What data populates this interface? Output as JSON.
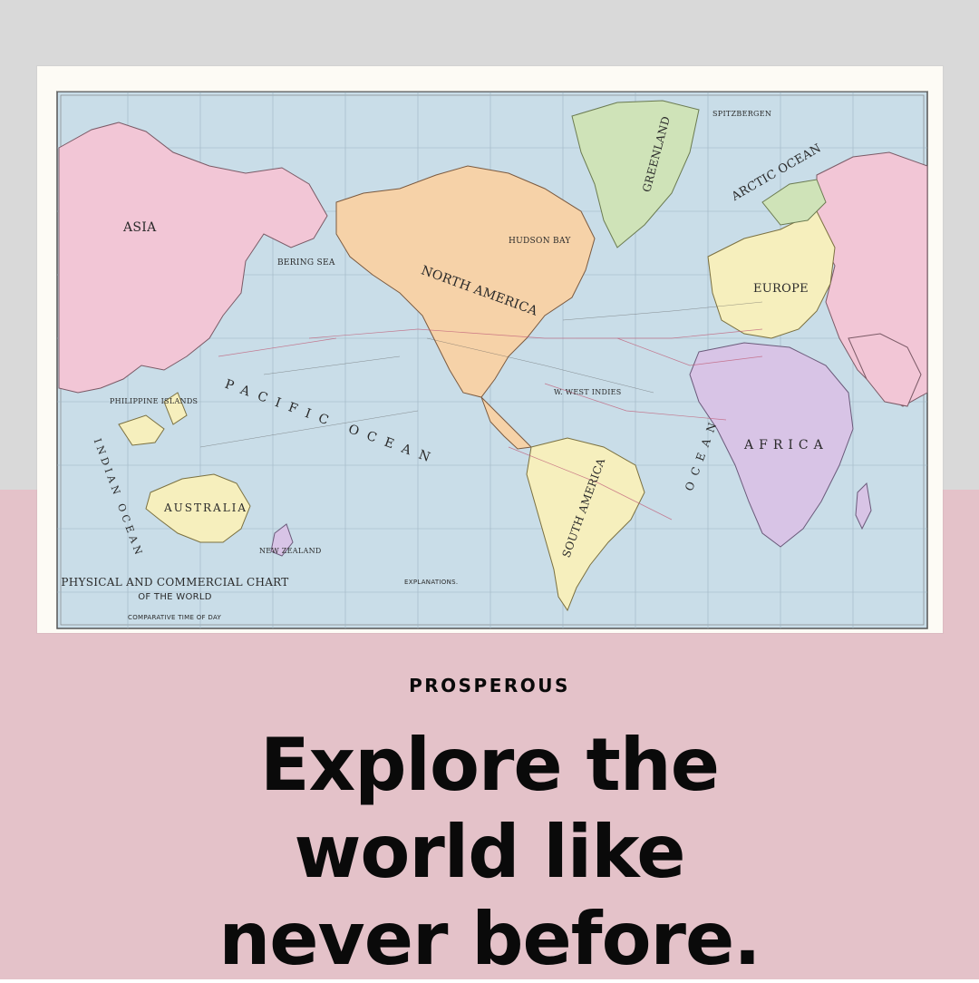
{
  "colors": {
    "top_background": "#d9d9d9",
    "bottom_background": "#e4c2c9",
    "ocean": "#c9dde8",
    "land_pink": "#f2c6d6",
    "land_orange": "#f6d2a8",
    "land_yellow": "#f6efbd",
    "land_green": "#cfe3b8",
    "land_purple": "#d8c4e6",
    "text": "#0a0a0a"
  },
  "map": {
    "title_line1": "PHYSICAL AND COMMERCIAL CHART",
    "title_line2": "OF THE WORLD",
    "subtitle": "COMPARATIVE TIME OF DAY",
    "explanations": "EXPLANATIONS.",
    "labels": {
      "greenland": "GREENLAND",
      "australia": "AUSTRALIA",
      "africa": "AFRICA",
      "north_america": "NORTH AMERICA",
      "pacific": "PACIFIC OCEAN",
      "indian": "INDIAN OCEAN",
      "arctic": "ARCTIC OCEAN",
      "europe": "EUROPE",
      "asia": "ASIA",
      "south_america": "SOUTH AMERICA",
      "atlantic": "OCEAN",
      "hudson_bay": "HUDSON BAY",
      "bering_sea": "BERING SEA",
      "philippine": "PHILIPPINE ISLANDS",
      "new_zealand": "NEW ZEALAND",
      "west_indies": "W. WEST INDIES",
      "spitzbergen": "SPITZBERGEN"
    }
  },
  "eyebrow": "PROSPEROUS",
  "headline": {
    "line1": "Explore the",
    "line2": "world like",
    "line3": "never before."
  }
}
